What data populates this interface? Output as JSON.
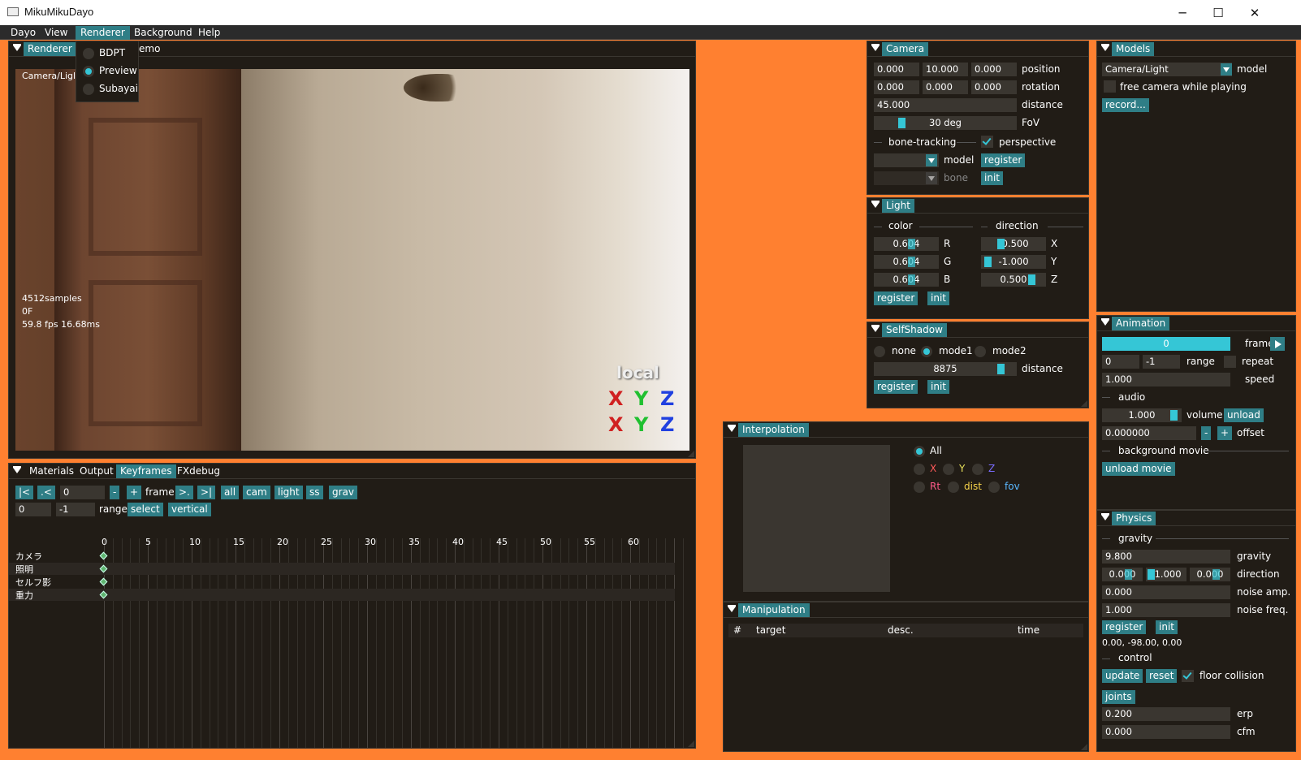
{
  "window": {
    "title": "MikuMikuDayo"
  },
  "menubar": {
    "items": [
      "Dayo",
      "View",
      "Renderer",
      "Background",
      "Help"
    ],
    "active": "Renderer"
  },
  "renderer_menu": {
    "items": [
      "BDPT",
      "Preview",
      "Subayai"
    ],
    "selected": "Preview"
  },
  "renderer": {
    "tabs": [
      "Renderer",
      "emo"
    ],
    "overlay_top": "Camera/Ligl",
    "overlay_stats": [
      "4512samples",
      "0F",
      "59.8 fps 16.68ms"
    ],
    "gizmo_label": "local",
    "gizmo_axes": [
      "X",
      "Y",
      "Z"
    ]
  },
  "camera": {
    "title": "Camera",
    "position": [
      "0.000",
      "10.000",
      "0.000"
    ],
    "position_label": "position",
    "rotation": [
      "0.000",
      "0.000",
      "0.000"
    ],
    "rotation_label": "rotation",
    "distance": "45.000",
    "distance_label": "distance",
    "fov": "30 deg",
    "fov_label": "FoV",
    "bone_tracking": "bone-tracking",
    "perspective": "perspective",
    "model_label": "model",
    "bone_label": "bone",
    "register": "register",
    "init": "init"
  },
  "light": {
    "title": "Light",
    "color_label": "color",
    "direction_label": "direction",
    "rows": [
      {
        "color": "0.604",
        "color_label": "R",
        "dir": "-0.500",
        "dir_label": "X"
      },
      {
        "color": "0.604",
        "color_label": "G",
        "dir": "-1.000",
        "dir_label": "Y"
      },
      {
        "color": "0.604",
        "color_label": "B",
        "dir": "0.500",
        "dir_label": "Z"
      }
    ],
    "register": "register",
    "init": "init"
  },
  "selfshadow": {
    "title": "SelfShadow",
    "options": [
      "none",
      "mode1",
      "mode2"
    ],
    "selected": "mode1",
    "distance": "8875",
    "distance_label": "distance",
    "register": "register",
    "init": "init"
  },
  "models": {
    "title": "Models",
    "model": "Camera/Light",
    "model_label": "model",
    "free_camera": "free camera while playing",
    "record": "record..."
  },
  "animation": {
    "title": "Animation",
    "frame": "0",
    "frame_label": "frame",
    "range_from": "0",
    "range_to": "-1",
    "range_label": "range",
    "repeat": "repeat",
    "speed": "1.000",
    "speed_label": "speed",
    "audio": "audio",
    "volume": "1.000",
    "volume_label": "volume",
    "unload": "unload",
    "offset": "0.000000",
    "offset_minus": "-",
    "offset_plus": "+",
    "offset_label": "offset",
    "background_movie": "background movie",
    "unload_movie": "unload movie"
  },
  "physics": {
    "title": "Physics",
    "gravity_header": "gravity",
    "gravity": "9.800",
    "gravity_label": "gravity",
    "direction": [
      "0.000",
      "-1.000",
      "0.000"
    ],
    "direction_label": "direction",
    "noise_amp": "0.000",
    "noise_amp_label": "noise amp.",
    "noise_freq": "1.000",
    "noise_freq_label": "noise freq.",
    "register": "register",
    "init": "init",
    "vector": "0.00, -98.00, 0.00",
    "control": "control",
    "update": "update",
    "reset": "reset",
    "floor_collision": "floor collision",
    "joints": "joints",
    "erp": "0.200",
    "erp_label": "erp",
    "cfm": "0.000",
    "cfm_label": "cfm"
  },
  "interpolation": {
    "title": "Interpolation",
    "all": "All",
    "axes": [
      {
        "label": "X",
        "color": "#ff5a5a"
      },
      {
        "label": "Y",
        "color": "#e6e05a"
      },
      {
        "label": "Z",
        "color": "#7a6cff"
      }
    ],
    "others": [
      {
        "label": "Rt",
        "color": "#ff5a8a"
      },
      {
        "label": "dist",
        "color": "#f5d24a"
      },
      {
        "label": "fov",
        "color": "#5ab8ff"
      }
    ]
  },
  "manipulation": {
    "title": "Manipulation",
    "columns": [
      "#",
      "target",
      "desc.",
      "time"
    ]
  },
  "keyframes": {
    "tabs": [
      "Materials",
      "Output",
      "Keyframes",
      "FXdebug"
    ],
    "active": "Keyframes",
    "nav": [
      "|<",
      ".<"
    ],
    "frame": "0",
    "minus": "-",
    "plus": "+",
    "frame_label": "frame",
    "nav2": [
      ">.",
      ">|"
    ],
    "filters": [
      "all",
      "cam",
      "light",
      "ss",
      "grav"
    ],
    "range_from": "0",
    "range_to": "-1",
    "range_label": "range",
    "select": "select",
    "vertical": "vertical",
    "ticks": [
      "0",
      "5",
      "10",
      "15",
      "20",
      "25",
      "30",
      "35",
      "40",
      "45",
      "50",
      "55",
      "60"
    ],
    "tracks": [
      "カメラ",
      "照明",
      "セルフ影",
      "重力"
    ]
  }
}
